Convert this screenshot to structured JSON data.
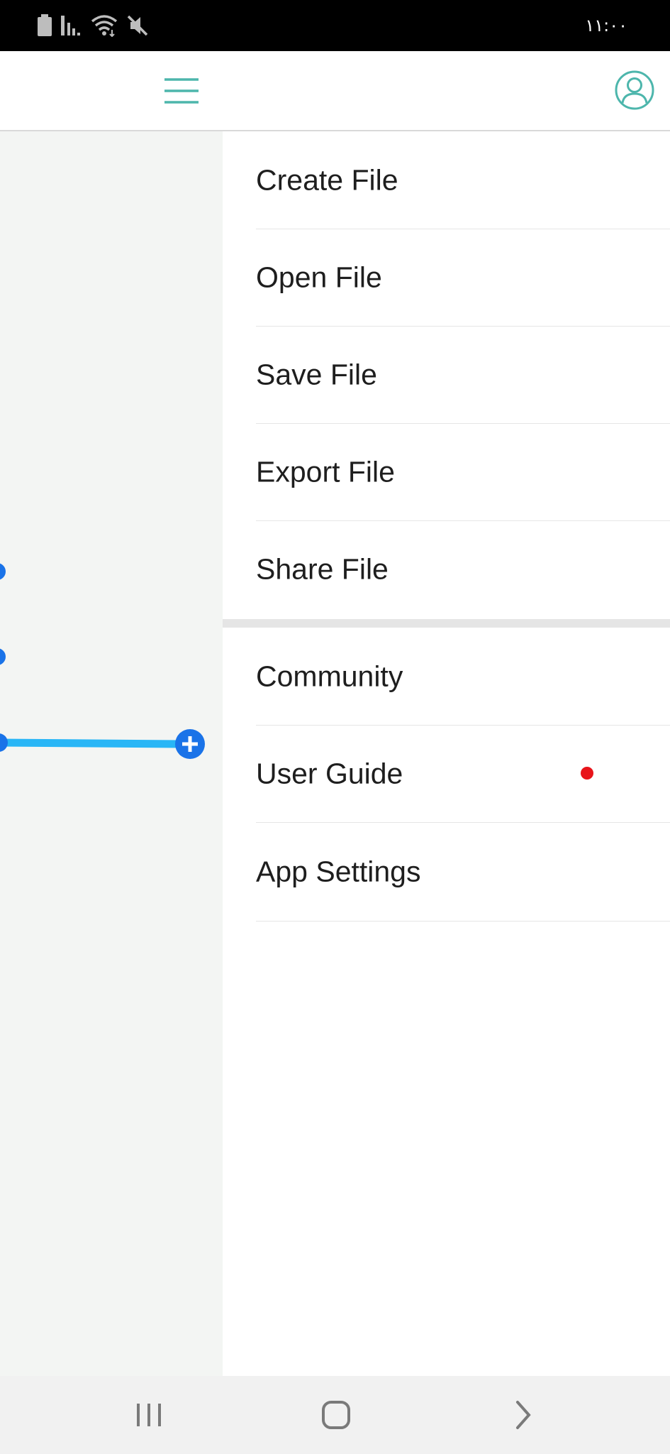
{
  "status_bar": {
    "time": "١١:٠٠",
    "icons": [
      "battery-icon",
      "signal-icon",
      "wifi-icon",
      "mute-icon"
    ]
  },
  "app_bar": {
    "menu_icon": "hamburger-menu-icon",
    "profile_icon": "user-profile-icon",
    "accent_color": "#4db6ac"
  },
  "canvas": {
    "node_color": "#1a73e8",
    "edge_color": "#29b6f6",
    "add_button_icon": "plus-circle-icon"
  },
  "drawer": {
    "file_section": [
      {
        "label": "Create File"
      },
      {
        "label": "Open File"
      },
      {
        "label": "Save File"
      },
      {
        "label": "Export File"
      },
      {
        "label": "Share File"
      }
    ],
    "app_section": [
      {
        "label": "Community"
      },
      {
        "label": "User Guide",
        "has_notification": true
      },
      {
        "label": "App Settings"
      }
    ],
    "notification_color": "#e8141a"
  },
  "nav_bar": {
    "recents_icon": "recent-apps-icon",
    "home_icon": "home-icon",
    "back_icon": "back-icon"
  }
}
